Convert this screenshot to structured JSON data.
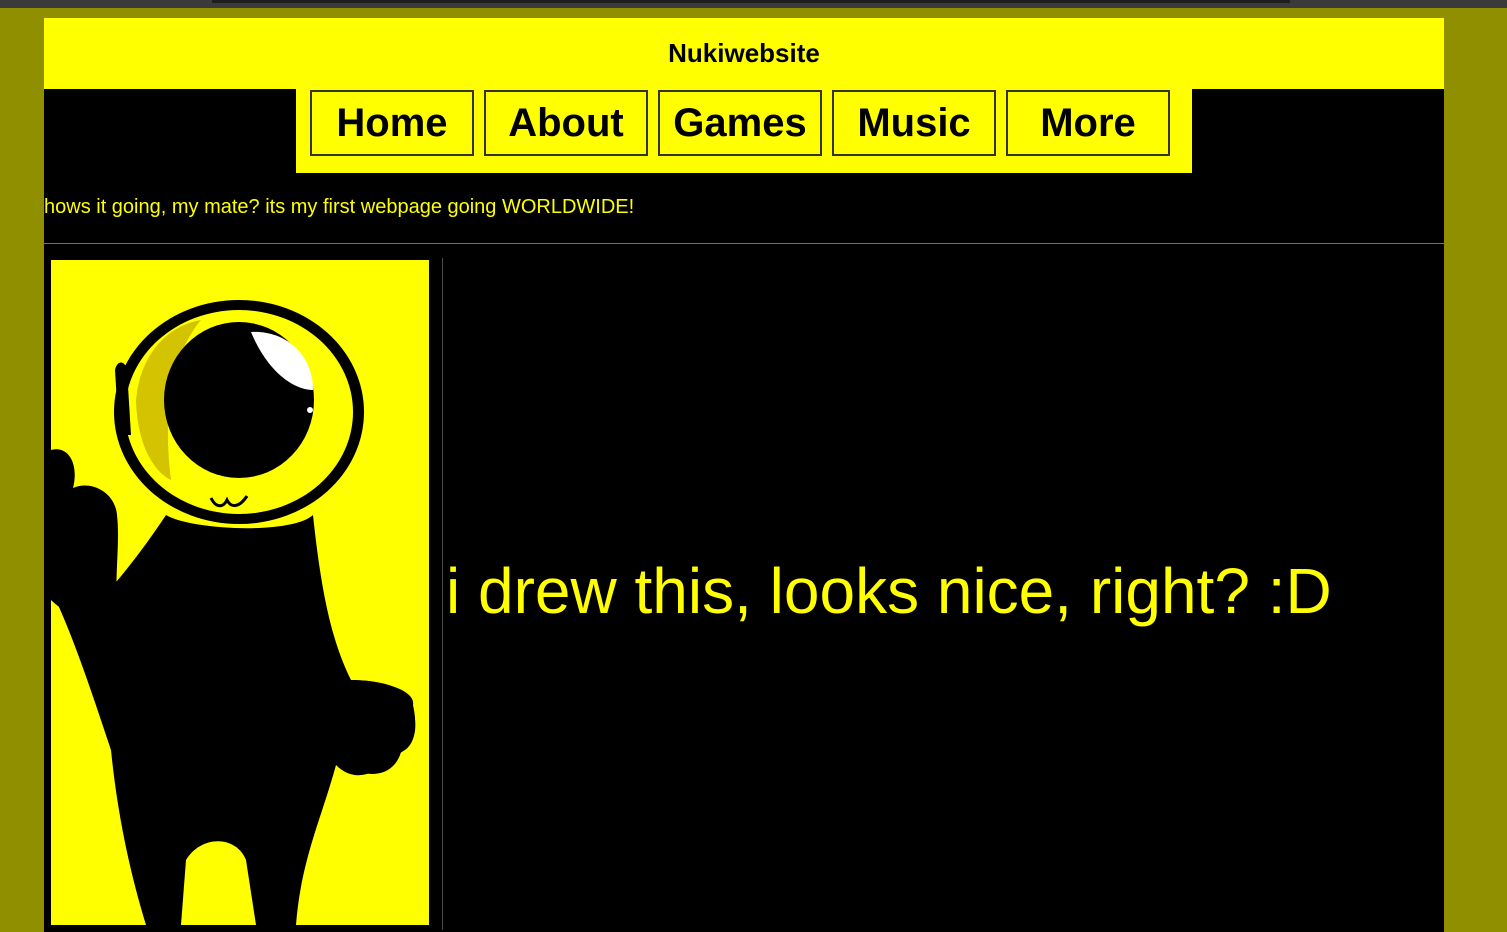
{
  "site": {
    "title": "Nukiwebsite"
  },
  "nav": {
    "items": [
      {
        "label": "Home"
      },
      {
        "label": "About"
      },
      {
        "label": "Games"
      },
      {
        "label": "Music"
      },
      {
        "label": "More"
      }
    ]
  },
  "main": {
    "greeting": "hows it going, my mate? its my first webpage going WORLDWIDE!",
    "caption": "i drew this, looks nice, right? :D"
  },
  "colors": {
    "background": "#8f8f00",
    "page": "#000000",
    "accent": "#ffff00"
  },
  "drawing": {
    "subject": "one-eyed yellow character icon"
  }
}
